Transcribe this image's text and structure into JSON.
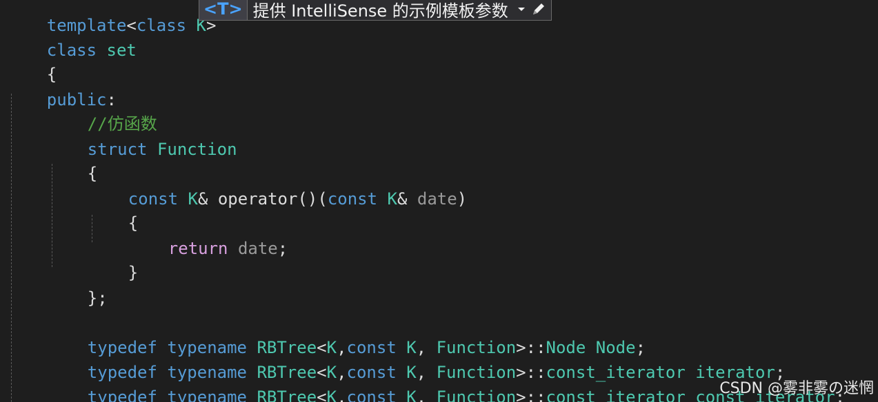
{
  "hint": {
    "tag": "<T>",
    "text": "提供 IntelliSense 的示例模板参数"
  },
  "code": {
    "l1": {
      "kw1": "template",
      "p1": "<",
      "kw2": "class",
      "sp": " ",
      "ty": "K",
      "p2": ">"
    },
    "l2": {
      "kw": "class",
      "name": " set"
    },
    "l3": {
      "p": "{"
    },
    "l4": {
      "kw": "public",
      "p": ":"
    },
    "l5": {
      "cm": "//仿函数"
    },
    "l6": {
      "kw": "struct",
      "ty": " Function"
    },
    "l7": {
      "p": "{"
    },
    "l8": {
      "kw1": "const",
      "ty1": " K",
      "p1": "& ",
      "fn": "operator",
      "p2": "()(",
      "kw2": "const",
      "ty2": " K",
      "p3": "& ",
      "id": "date",
      "p4": ")"
    },
    "l9": {
      "p": "{"
    },
    "l10": {
      "ctl": "return",
      "id": " date",
      "p": ";"
    },
    "l11": {
      "p": "}"
    },
    "l12": {
      "p": "};"
    },
    "l13": {
      "kw1": "typedef",
      "kw2": " typename",
      "ty1": " RBTree",
      "p1": "<",
      "ty2": "K",
      "p2": ",",
      "kw3": "const",
      "ty3": " K",
      "p3": ", ",
      "ty4": "Function",
      "p4": ">::",
      "ty5": "Node",
      "ty6": " Node",
      "p5": ";"
    },
    "l14": {
      "kw1": "typedef",
      "kw2": " typename",
      "ty1": " RBTree",
      "p1": "<",
      "ty2": "K",
      "p2": ",",
      "kw3": "const",
      "ty3": " K",
      "p3": ", ",
      "ty4": "Function",
      "p4": ">::",
      "ty5": "const_iterator",
      "ty6": " iterator",
      "p5": ";"
    },
    "l15": {
      "kw1": "typedef",
      "kw2": " typename",
      "ty1": " RBTree",
      "p1": "<",
      "ty2": "K",
      "p2": ",",
      "kw3": "const",
      "ty3": " K",
      "p3": ", ",
      "ty4": "Function",
      "p4": ">::",
      "ty5": "const_iterator",
      "ty6": " const_iterator",
      "p5": ";"
    }
  },
  "watermark": "CSDN @雾非雾の迷惘",
  "colors": {
    "background": "#1e1e1e",
    "keyword": "#569cd6",
    "type": "#4ec9b0",
    "control": "#d8a0df",
    "comment": "#57a64a",
    "hint_tag": "#4aa3ff"
  },
  "icons": {
    "dropdown": "chevron-down-icon",
    "edit": "pencil-icon"
  }
}
